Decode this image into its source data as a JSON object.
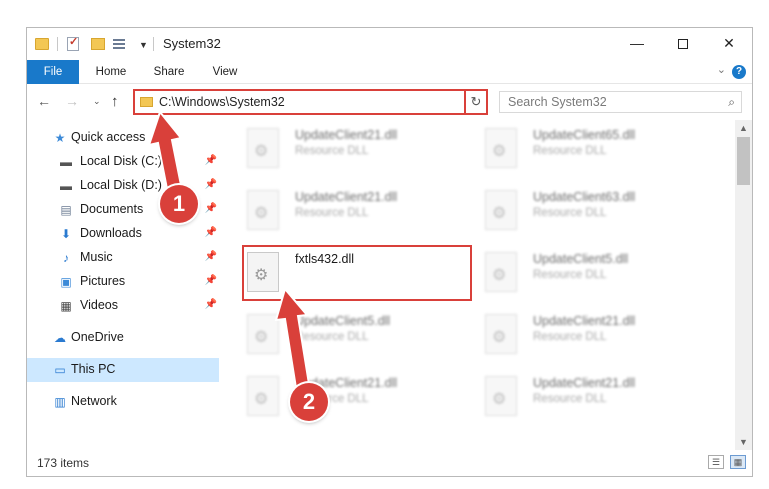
{
  "window": {
    "title": "System32",
    "controls": {
      "minimize": "—",
      "maximize": "",
      "close": "✕"
    }
  },
  "ribbon": {
    "tabs": [
      "File",
      "Home",
      "Share",
      "View"
    ]
  },
  "address": {
    "path": "C:\\Windows\\System32",
    "search_placeholder": "Search System32"
  },
  "sidebar": {
    "items": [
      {
        "label": "Quick access",
        "icon": "star-icon",
        "pinned": false
      },
      {
        "label": "Local Disk (C:)",
        "icon": "drive-icon",
        "pinned": true
      },
      {
        "label": "Local Disk (D:)",
        "icon": "drive-icon",
        "pinned": true
      },
      {
        "label": "Documents",
        "icon": "documents-icon",
        "pinned": true
      },
      {
        "label": "Downloads",
        "icon": "download-icon",
        "pinned": true
      },
      {
        "label": "Music",
        "icon": "music-icon",
        "pinned": true
      },
      {
        "label": "Pictures",
        "icon": "pictures-icon",
        "pinned": true
      },
      {
        "label": "Videos",
        "icon": "videos-icon",
        "pinned": true
      },
      {
        "label": "OneDrive",
        "icon": "cloud-icon",
        "pinned": false
      },
      {
        "label": "This PC",
        "icon": "computer-icon",
        "pinned": false,
        "selected": true
      },
      {
        "label": "Network",
        "icon": "network-icon",
        "pinned": false
      }
    ]
  },
  "files": [
    {
      "name": "UpdateClient21.dll",
      "type": "Resource DLL",
      "blurred": true
    },
    {
      "name": "UpdateClient65.dll",
      "type": "Resource DLL",
      "blurred": true
    },
    {
      "name": "UpdateClient21.dll",
      "type": "Resource DLL",
      "blurred": true
    },
    {
      "name": "UpdateClient63.dll",
      "type": "Resource DLL",
      "blurred": true
    },
    {
      "name": "fxtls432.dll",
      "type": "",
      "blurred": false,
      "highlighted": true
    },
    {
      "name": "UpdateClient5.dll",
      "type": "Resource DLL",
      "blurred": true
    },
    {
      "name": "UpdateClient5.dll",
      "type": "Resource DLL",
      "blurred": true
    },
    {
      "name": "UpdateClient21.dll",
      "type": "Resource DLL",
      "blurred": true
    },
    {
      "name": "UpdateClient21.dll",
      "type": "Resource DLL",
      "blurred": true
    },
    {
      "name": "UpdateClient21.dll",
      "type": "Resource DLL",
      "blurred": true
    }
  ],
  "status": {
    "item_count": "173 items"
  },
  "annotations": {
    "step1": "1",
    "step2": "2",
    "accent_color": "#d9403a"
  }
}
